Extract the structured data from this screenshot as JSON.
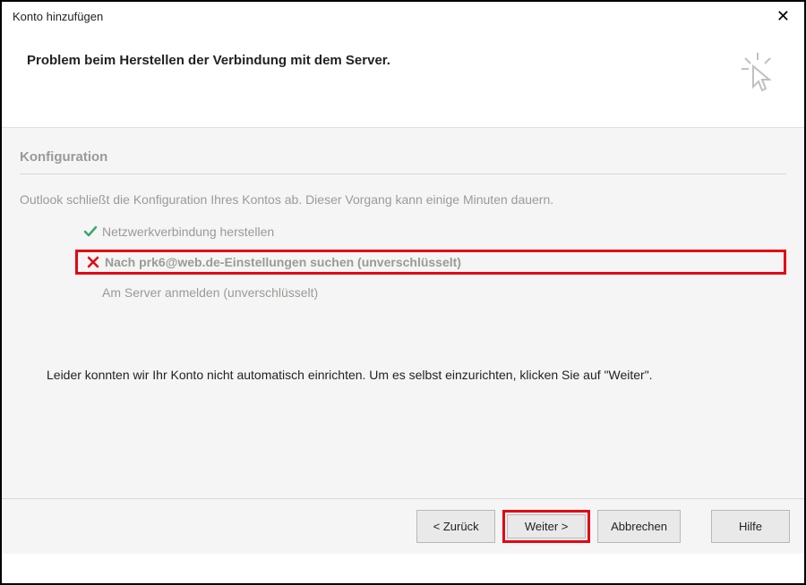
{
  "window": {
    "title": "Konto hinzufügen"
  },
  "header": {
    "message": "Problem beim Herstellen der Verbindung mit dem Server."
  },
  "section": {
    "title": "Konfiguration",
    "intro": "Outlook schließt die Konfiguration Ihres Kontos ab. Dieser Vorgang kann einige Minuten dauern."
  },
  "steps": {
    "network": "Netzwerkverbindung herstellen",
    "search": "Nach prk6@web.de-Einstellungen suchen (unverschlüsselt)",
    "login": "Am Server anmelden (unverschlüsselt)"
  },
  "summary": "Leider konnten wir Ihr Konto nicht automatisch einrichten. Um es selbst einzurichten, klicken Sie auf \"Weiter\".",
  "buttons": {
    "back": "< Zurück",
    "next": "Weiter >",
    "cancel": "Abbrechen",
    "help": "Hilfe"
  },
  "colors": {
    "highlight": "#e30613",
    "success": "#3aa76d",
    "muted": "#9a9a98"
  }
}
